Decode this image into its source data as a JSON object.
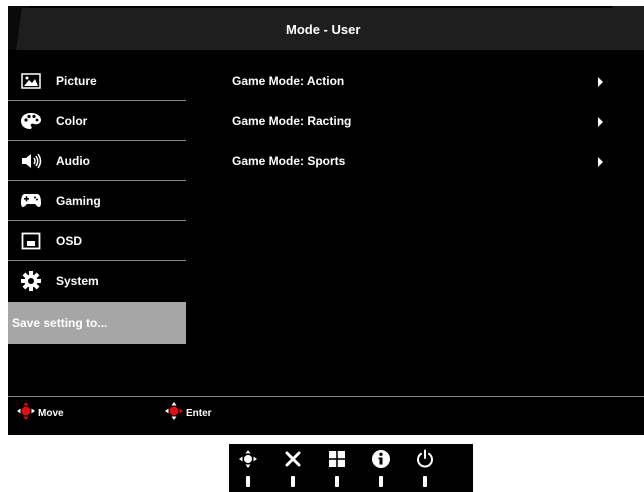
{
  "header": {
    "title": "Mode - User"
  },
  "sidebar": {
    "items": [
      {
        "label": "Picture",
        "icon": "picture-icon"
      },
      {
        "label": "Color",
        "icon": "palette-icon"
      },
      {
        "label": "Audio",
        "icon": "speaker-icon"
      },
      {
        "label": "Gaming",
        "icon": "gamepad-icon"
      },
      {
        "label": "OSD",
        "icon": "osd-icon"
      },
      {
        "label": "System",
        "icon": "gear-icon"
      }
    ],
    "save_label": "Save setting to..."
  },
  "main": {
    "items": [
      {
        "label": "Game Mode: Action"
      },
      {
        "label": "Game Mode: Racting"
      },
      {
        "label": "Game Mode: Sports"
      }
    ]
  },
  "footer": {
    "move_label": "Move",
    "enter_label": "Enter"
  },
  "hardware_buttons": [
    {
      "icon": "navigation-joystick-icon"
    },
    {
      "icon": "close-icon"
    },
    {
      "icon": "grid-icon"
    },
    {
      "icon": "info-icon"
    },
    {
      "icon": "power-icon"
    }
  ],
  "colors": {
    "background": "#000000",
    "selection": "#a6a6a6",
    "header": "#1e1e1e",
    "accent_red": "#e01010"
  }
}
